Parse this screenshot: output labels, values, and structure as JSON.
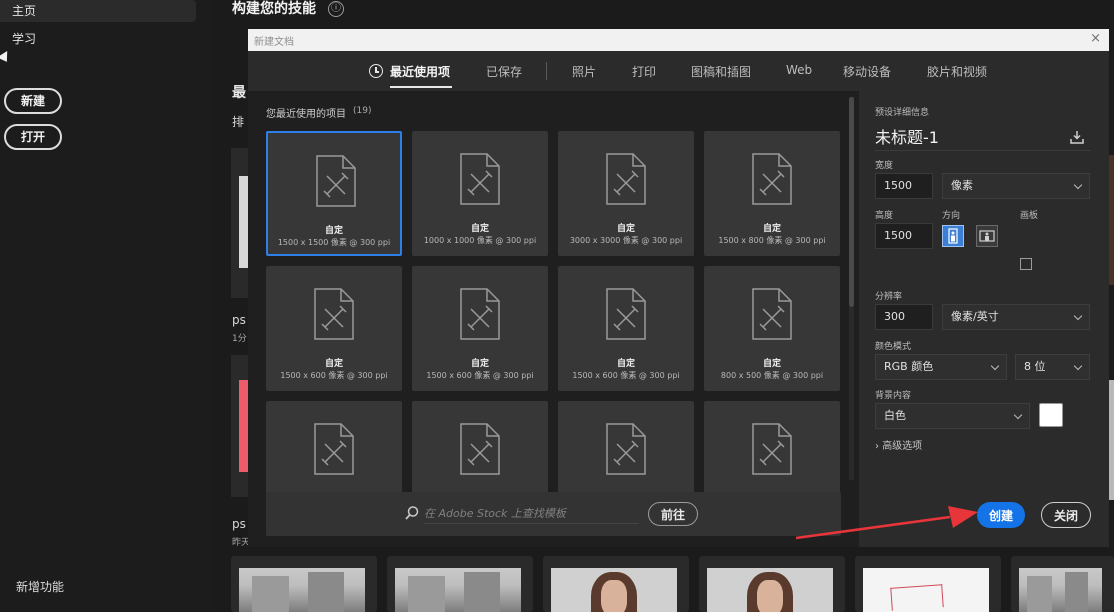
{
  "home": {
    "sidebar": {
      "items": [
        "主页",
        "学习"
      ],
      "new_button": "新建",
      "open_button": "打开",
      "whats_new": "新增功能"
    },
    "title": "构建您的技能",
    "info_icon": "ⓘ",
    "fragments": {
      "recent_heading": "最",
      "sort": "排",
      "file_a": "ps",
      "file_a_time": "1分",
      "file_b": "ps",
      "file_b_time": "昨天"
    }
  },
  "dialog": {
    "title": "新建文档",
    "close_glyph": "×",
    "tabs": [
      "最近使用项",
      "已保存",
      "照片",
      "打印",
      "图稿和插图",
      "Web",
      "移动设备",
      "胶片和视频"
    ],
    "recent_label": "您最近使用的项目",
    "recent_count": "(19)",
    "presets": [
      {
        "name": "自定",
        "dims": "1500 x 1500 像素 @ 300 ppi"
      },
      {
        "name": "自定",
        "dims": "1000 x 1000 像素 @ 300 ppi"
      },
      {
        "name": "自定",
        "dims": "3000 x 3000 像素 @ 300 ppi"
      },
      {
        "name": "自定",
        "dims": "1500 x 800 像素 @ 300 ppi"
      },
      {
        "name": "自定",
        "dims": "1500 x 600 像素 @ 300 ppi"
      },
      {
        "name": "自定",
        "dims": "1500 x 600 像素 @ 300 ppi"
      },
      {
        "name": "自定",
        "dims": "1500 x 600 像素 @ 300 ppi"
      },
      {
        "name": "自定",
        "dims": "800 x 500 像素 @ 300 ppi"
      },
      {
        "name": "",
        "dims": ""
      },
      {
        "name": "",
        "dims": ""
      },
      {
        "name": "",
        "dims": ""
      },
      {
        "name": "",
        "dims": ""
      }
    ],
    "stock": {
      "placeholder": "在 Adobe Stock 上查找模板",
      "go_label": "前往"
    },
    "details": {
      "section_label": "预设详细信息",
      "doc_name": "未标题-1",
      "width_label": "宽度",
      "width_value": "1500",
      "width_unit": "像素",
      "height_label": "高度",
      "height_value": "1500",
      "orientation_label": "方向",
      "artboard_label": "画板",
      "resolution_label": "分辨率",
      "resolution_value": "300",
      "resolution_unit": "像素/英寸",
      "color_mode_label": "颜色模式",
      "color_mode": "RGB 颜色",
      "bit_depth": "8 位",
      "background_label": "背景内容",
      "background_value": "白色",
      "advanced_label": "高级选项",
      "create_label": "创建",
      "close_label": "关闭"
    }
  },
  "colors": {
    "accent": "#1473e6",
    "selection": "#2f7fe8",
    "annotation_arrow": "#e8353a"
  }
}
